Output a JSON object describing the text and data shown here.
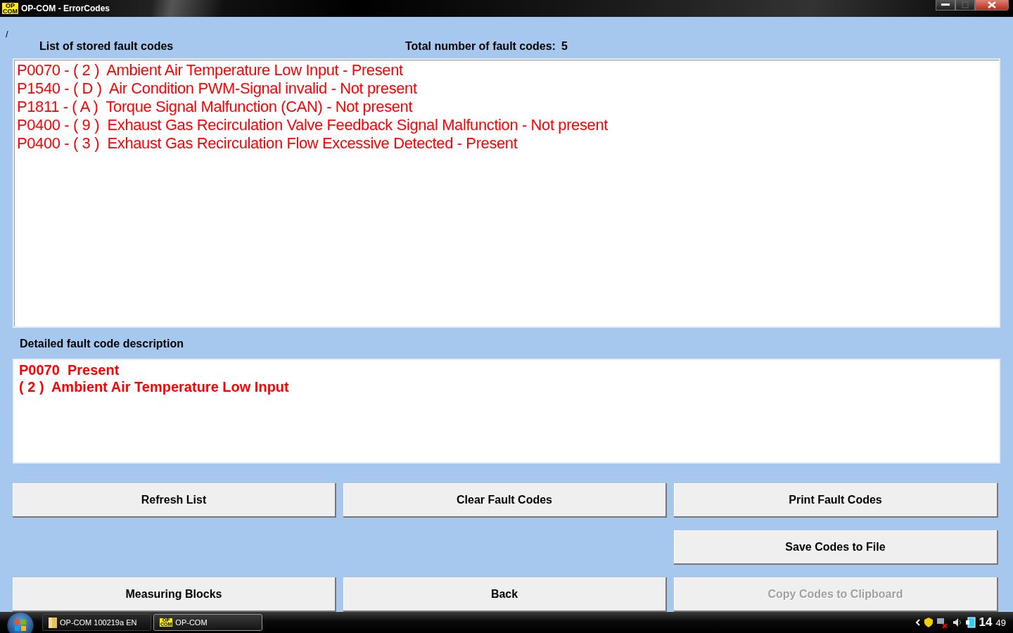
{
  "window": {
    "title": "OP-COM - ErrorCodes",
    "app_badge": [
      "OP",
      "COM"
    ]
  },
  "corner_mark": "/",
  "list_heading": "List of stored fault codes",
  "total_label": "Total number of fault codes:",
  "total_value": "5",
  "fault_codes": [
    {
      "text": "P0070 - ( 2 )  Ambient Air Temperature Low Input - Present"
    },
    {
      "text": "P1540 - ( D )  Air Condition PWM-Signal invalid - Not present"
    },
    {
      "text": "P1811 - ( A )  Torque Signal Malfunction (CAN) - Not present"
    },
    {
      "text": "P0400 - ( 9 )  Exhaust Gas Recirculation Valve Feedback Signal Malfunction - Not present"
    },
    {
      "text": "P0400 - ( 3 )  Exhaust Gas Recirculation Flow Excessive Detected - Present"
    }
  ],
  "detail_heading": "Detailed fault code description",
  "detail_lines": [
    "P0070  Present",
    "( 2 )  Ambient Air Temperature Low Input"
  ],
  "button_rows": [
    [
      {
        "label": "Refresh List",
        "disabled": false
      },
      {
        "label": "Clear Fault Codes",
        "disabled": false
      },
      {
        "label": "Print Fault Codes",
        "disabled": false
      }
    ],
    [
      {
        "label": "Save Codes to File",
        "disabled": false
      }
    ],
    [
      {
        "label": "Measuring Blocks",
        "disabled": false
      },
      {
        "label": "Back",
        "disabled": false
      },
      {
        "label": "Copy Codes to Clipboard",
        "disabled": true
      }
    ]
  ],
  "taskbar": {
    "items": [
      {
        "label": "OP-COM 100219a EN",
        "kind": "folder",
        "selected": false
      },
      {
        "label": "OP-COM",
        "kind": "app",
        "selected": true,
        "app_badge": [
          "OP",
          "COM"
        ]
      }
    ],
    "clock_hour": "14",
    "clock_minute": "49"
  }
}
